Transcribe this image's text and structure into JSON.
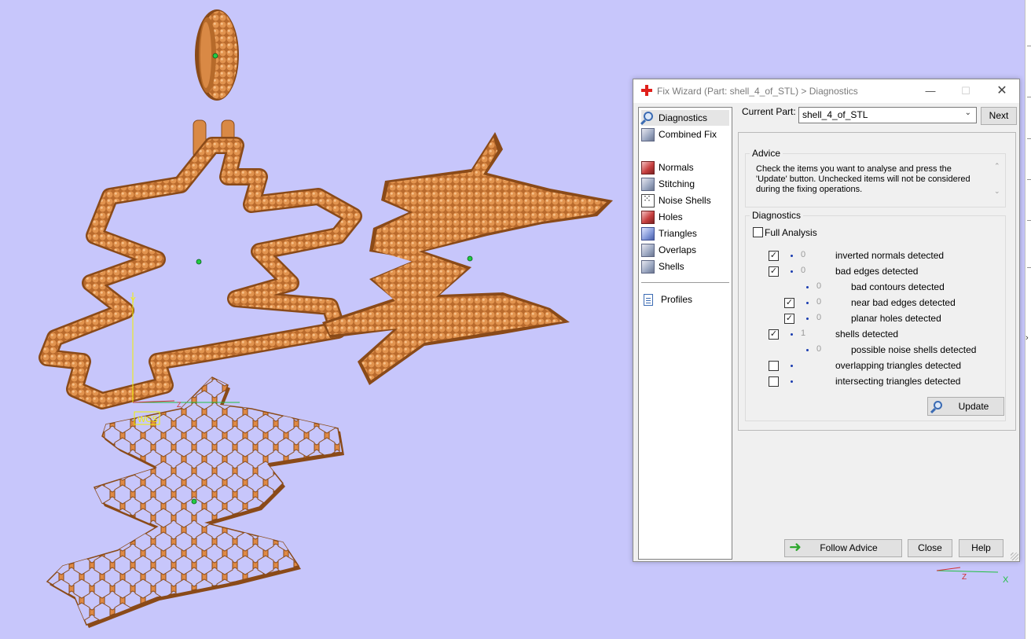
{
  "scene": {
    "wcs_label": "WCS",
    "axis_z_label": "Z",
    "mini_axis": {
      "z": "Z",
      "x": "X"
    }
  },
  "dialog": {
    "title": "Fix Wizard (Part: shell_4_of_STL) > Diagnostics",
    "min_glyph": "—",
    "max_glyph": "☐",
    "close_glyph": "✕",
    "nav": {
      "items": [
        {
          "label": "Diagnostics",
          "icon": "magnifier-icon",
          "selected": true
        },
        {
          "label": "Combined Fix",
          "icon": "cube-icon"
        },
        {
          "label": "Normals",
          "icon": "red-cube-icon"
        },
        {
          "label": "Stitching",
          "icon": "cube-icon"
        },
        {
          "label": "Noise Shells",
          "icon": "dice-icon"
        },
        {
          "label": "Holes",
          "icon": "red-cube-icon"
        },
        {
          "label": "Triangles",
          "icon": "blue-cube-icon"
        },
        {
          "label": "Overlaps",
          "icon": "cube-icon"
        },
        {
          "label": "Shells",
          "icon": "cube-icon"
        },
        {
          "label": "Profiles",
          "icon": "document-icon"
        }
      ]
    },
    "current_part_label": "Current Part:",
    "current_part_value": "shell_4_of_STL",
    "next_label": "Next",
    "advice": {
      "title": "Advice",
      "text": "Check the items you want to analyse and press the 'Update' button. Unchecked items will not be considered during the fixing operations."
    },
    "diagnostics": {
      "title": "Diagnostics",
      "full_analysis_label": "Full Analysis",
      "full_analysis_checked": false,
      "rows": [
        {
          "checkbox": true,
          "checked": true,
          "count": "0",
          "label": "inverted normals detected",
          "indent": 0
        },
        {
          "checkbox": true,
          "checked": true,
          "count": "0",
          "label": "bad edges detected",
          "indent": 0
        },
        {
          "checkbox": false,
          "checked": false,
          "count": "0",
          "label": "bad contours detected",
          "indent": 1
        },
        {
          "checkbox": true,
          "checked": true,
          "count": "0",
          "label": "near bad edges detected",
          "indent": 1
        },
        {
          "checkbox": true,
          "checked": true,
          "count": "0",
          "label": "planar holes detected",
          "indent": 1
        },
        {
          "checkbox": true,
          "checked": true,
          "count": "1",
          "label": "shells detected",
          "indent": 0
        },
        {
          "checkbox": false,
          "checked": false,
          "count": "0",
          "label": "possible noise shells detected",
          "indent": 1
        },
        {
          "checkbox": true,
          "checked": false,
          "count": "",
          "label": "overlapping triangles detected",
          "indent": 0
        },
        {
          "checkbox": true,
          "checked": false,
          "count": "",
          "label": "intersecting triangles detected",
          "indent": 0
        }
      ],
      "update_label": "Update"
    },
    "follow_advice_label": "Follow Advice",
    "close_label": "Close",
    "help_label": "Help"
  },
  "colors": {
    "background": "#c7c6fb",
    "part_fill": "#e08a45",
    "part_dark": "#8a4a18",
    "marker": "#22cc44"
  }
}
